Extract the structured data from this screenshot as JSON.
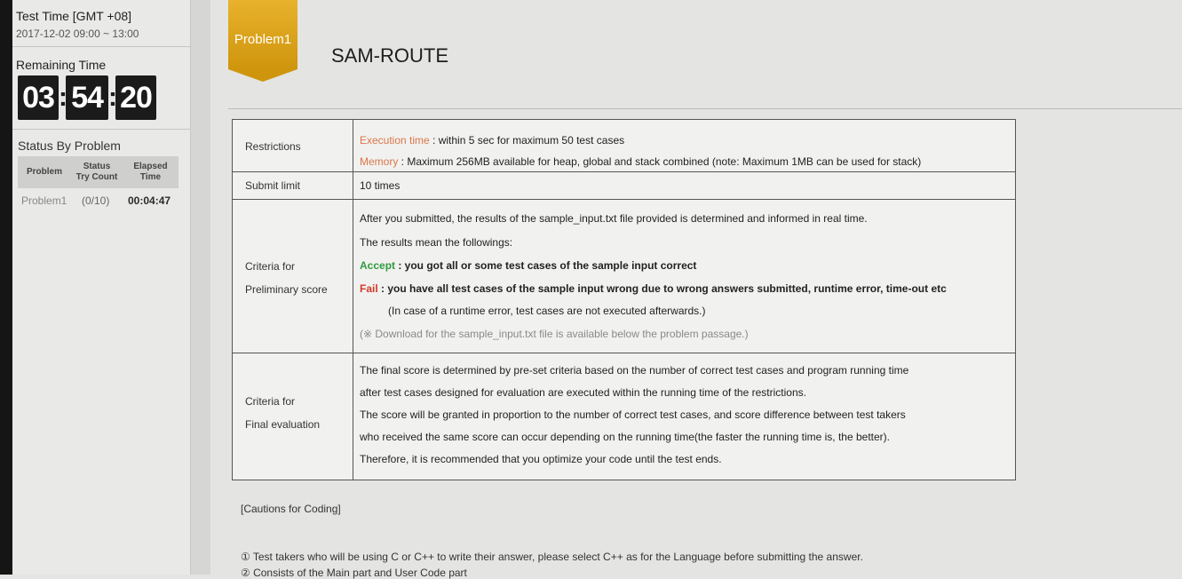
{
  "sidebar": {
    "test_time_label": "Test Time [GMT +08]",
    "test_time_range": "2017-12-02 09:00 ~ 13:00",
    "remaining_label": "Remaining Time",
    "clock": {
      "hours": "03",
      "minutes": "54",
      "seconds": "20"
    },
    "status_label": "Status By Problem",
    "status_headers": {
      "problem": "Problem",
      "status": "Status",
      "try_count": "Try Count",
      "elapsed": "Elapsed",
      "time": "Time"
    },
    "status_row": {
      "problem": "Problem1",
      "count": "(0/10)",
      "elapsed": "00:04:47"
    }
  },
  "problem": {
    "badge": "Problem1",
    "title": "SAM-ROUTE"
  },
  "table": {
    "restrictions": {
      "label": "Restrictions",
      "exec_key": "Execution time",
      "exec_val": " : within 5 sec for maximum 50 test cases",
      "mem_key": "Memory",
      "mem_val": " : Maximum 256MB available for heap, global and stack combined (note: Maximum 1MB can be used for stack)"
    },
    "submit": {
      "label": "Submit limit",
      "value": "10 times"
    },
    "preliminary": {
      "label1": "Criteria for",
      "label2": "Preliminary score",
      "line1": "After you submitted, the results of the sample_input.txt file provided is determined and informed in real time.",
      "line2": "The results mean the followings:",
      "accept_key": "Accept",
      "accept_val": " : you got all or some test cases of the sample input correct",
      "fail_key": "Fail",
      "fail_val": " : you have all test cases of the sample input wrong due to wrong answers submitted, runtime error, time-out etc",
      "runtime_note": "(In case of a runtime error, test cases are not executed afterwards.)",
      "download_note": "(※ Download for the sample_input.txt file is available below the problem passage.)"
    },
    "final": {
      "label1": "Criteria for",
      "label2": "Final evaluation",
      "line1": "The final score is determined by pre-set criteria based on the number of correct test cases and program running time",
      "line2": "after test cases designed for evaluation are executed within the running time of the restrictions.",
      "line3": "The score will be granted in proportion to the number of correct test cases, and score difference between test takers",
      "line4": "who received the same score can occur depending on the running time(the faster the running time is, the better).",
      "line5": "Therefore, it is recommended that you optimize your code until the test ends."
    }
  },
  "cautions": {
    "title": "[Cautions for Coding]",
    "item1": "① Test takers who will be using C or C++ to write their answer, please select C++ as for the Language before submitting the answer.",
    "item2": "② Consists of the Main part and User Code part"
  }
}
